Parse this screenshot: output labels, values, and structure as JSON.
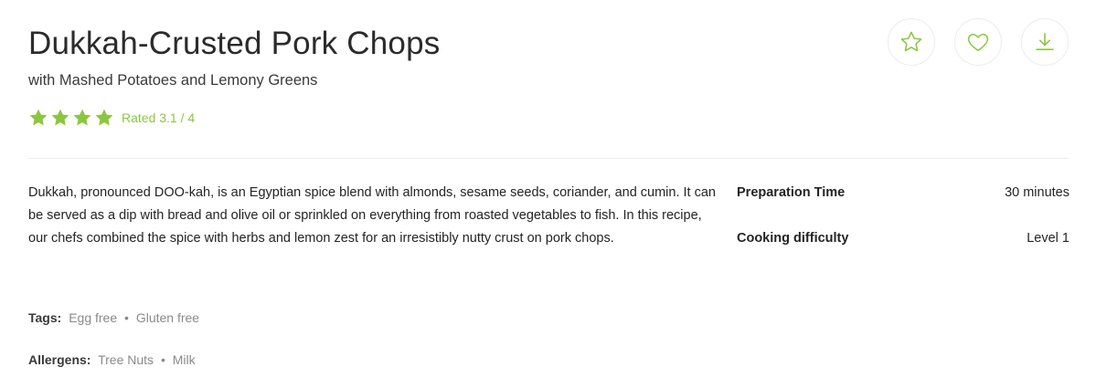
{
  "recipe": {
    "title": "Dukkah-Crusted Pork Chops",
    "subtitle": "with Mashed Potatoes and Lemony Greens",
    "rating": {
      "stars_filled": 4,
      "text": "Rated 3.1 / 4"
    },
    "description": "Dukkah, pronounced DOO-kah, is an Egyptian spice blend with almonds, sesame seeds, coriander, and cumin. It can be served as a dip with bread and olive oil or sprinkled on everything from roasted vegetables to fish. In this recipe, our chefs combined the spice with herbs and lemon zest for an irresistibly nutty crust on pork chops.",
    "info": [
      {
        "label": "Preparation Time",
        "value": "30 minutes"
      },
      {
        "label": "Cooking difficulty",
        "value": "Level 1"
      }
    ],
    "tags": {
      "label": "Tags:",
      "items": [
        "Egg free",
        "Gluten free"
      ]
    },
    "allergens": {
      "label": "Allergens:",
      "items": [
        "Tree Nuts",
        "Milk"
      ]
    },
    "separator": "•"
  },
  "actions": [
    {
      "name": "favorite",
      "icon": "star-outline-icon"
    },
    {
      "name": "like",
      "icon": "heart-outline-icon"
    },
    {
      "name": "download",
      "icon": "download-icon"
    }
  ],
  "colors": {
    "accent": "#8cc63f",
    "text": "#242424",
    "muted": "#8a8a8a",
    "divider": "#eeeeee"
  }
}
